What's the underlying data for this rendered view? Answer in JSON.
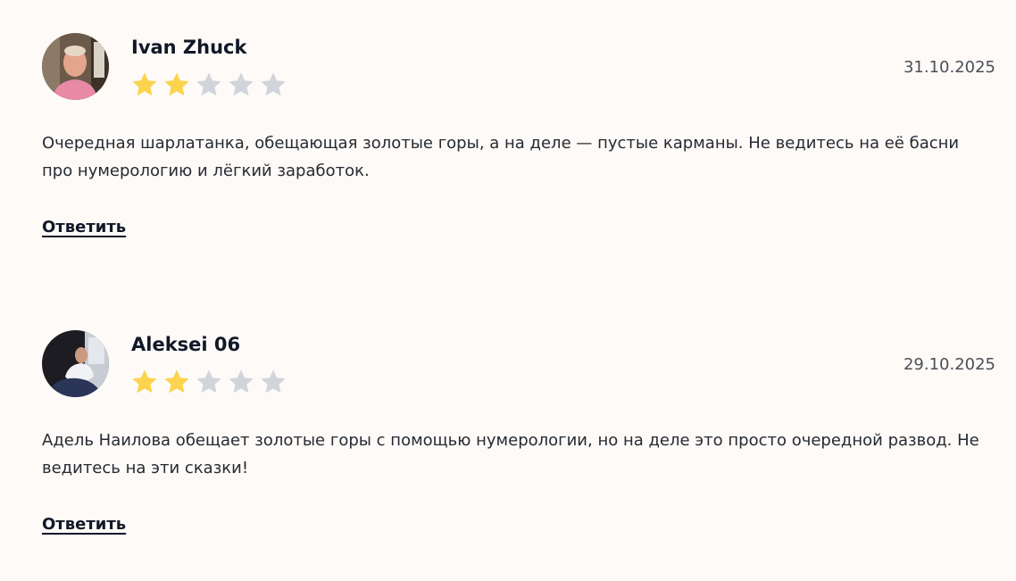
{
  "reviews": [
    {
      "author": "Ivan Zhuck",
      "date": "31.10.2025",
      "rating": 2,
      "rating_max": 5,
      "text": "Очередная шарлатанка, обещающая золотые горы, а на деле — пустые карманы. Не ведитесь на её басни про нумерологию и лёгкий заработок.",
      "reply_label": "Ответить"
    },
    {
      "author": "Aleksei 06",
      "date": "29.10.2025",
      "rating": 2,
      "rating_max": 5,
      "text": "Адель Наилова обещает золотые горы с помощью нумерологии, но на деле это просто очередной развод. Не ведитесь на эти сказки!",
      "reply_label": "Ответить"
    }
  ],
  "colors": {
    "background": "#fdfaf7",
    "star_filled": "#fcd34d",
    "star_empty": "#d1d5db",
    "text": "#1a1f2e"
  },
  "icons": {
    "star": "star-icon"
  }
}
